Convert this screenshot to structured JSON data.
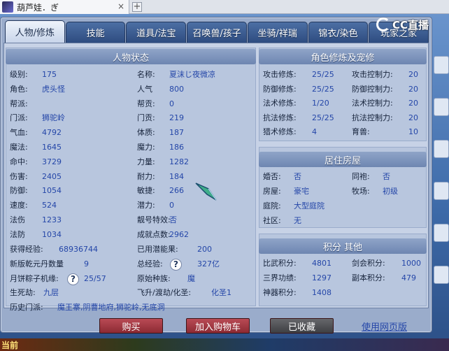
{
  "browser": {
    "tab_title": "葫芦娃．ぎ",
    "close_glyph": "×",
    "new_tab_glyph": "+"
  },
  "watermark": {
    "text": "CC直播"
  },
  "tabs": [
    {
      "label": "人物/修炼"
    },
    {
      "label": "技能"
    },
    {
      "label": "道具/法宝"
    },
    {
      "label": "召唤兽/孩子"
    },
    {
      "label": "坐骑/祥瑞"
    },
    {
      "label": "锦衣/染色"
    },
    {
      "label": "玩家之家"
    }
  ],
  "status": {
    "header": "人物状态",
    "left": [
      {
        "label": "级别:",
        "value": "175"
      },
      {
        "label": "角色:",
        "value": "虎头怪"
      },
      {
        "label": "帮派:",
        "value": ""
      },
      {
        "label": "门派:",
        "value": "狮驼岭"
      },
      {
        "label": "气血:",
        "value": "4792"
      },
      {
        "label": "魔法:",
        "value": "1645"
      },
      {
        "label": "命中:",
        "value": "3729"
      },
      {
        "label": "伤害:",
        "value": "2405"
      },
      {
        "label": "防御:",
        "value": "1054"
      },
      {
        "label": "速度:",
        "value": "524"
      },
      {
        "label": "法伤",
        "value": "1233"
      },
      {
        "label": "法防",
        "value": "1034"
      }
    ],
    "right": [
      {
        "label": "名称:",
        "value": "夏沫じ夜微凉"
      },
      {
        "label": "人气",
        "value": "800"
      },
      {
        "label": "帮贡:",
        "value": "0"
      },
      {
        "label": "门贡:",
        "value": "219"
      },
      {
        "label": "体质:",
        "value": "187"
      },
      {
        "label": "魔力:",
        "value": "186"
      },
      {
        "label": "力量:",
        "value": "1282"
      },
      {
        "label": "耐力:",
        "value": "184"
      },
      {
        "label": "敏捷:",
        "value": "266"
      },
      {
        "label": "潜力:",
        "value": "0"
      },
      {
        "label": "靓号特效:",
        "value": "否"
      },
      {
        "label": "成就点数:",
        "value": "2962"
      }
    ],
    "exp": {
      "label": "获得经验:",
      "value": "68936744"
    },
    "potential": {
      "label": "已用潜能果:",
      "value": "200"
    },
    "qianyuan": {
      "label": "新版乾元丹数量",
      "value": "9"
    },
    "total_exp": {
      "label": "总经验:",
      "help": "?",
      "value": "327亿"
    },
    "moon": {
      "label": "月饼粽子机缘:",
      "help": "?",
      "value": "25/57"
    },
    "race": {
      "label": "原始种族:",
      "value": "魔"
    },
    "life": {
      "label": "生死劫:",
      "value": "九层"
    },
    "ascend": {
      "label": "飞升/渡劫/化圣:",
      "value": "化圣1"
    },
    "history": {
      "label": "历史门派:",
      "value": "魔王寨,阴曹地府,狮驼岭,无底洞"
    }
  },
  "cultivation": {
    "header": "角色修炼及宠修",
    "rows": [
      {
        "l1": "攻击修炼:",
        "v1": "25/25",
        "l2": "攻击控制力:",
        "v2": "20"
      },
      {
        "l1": "防御修炼:",
        "v1": "25/25",
        "l2": "防御控制力:",
        "v2": "20"
      },
      {
        "l1": "法术修炼:",
        "v1": "1/20",
        "l2": "法术控制力:",
        "v2": "20"
      },
      {
        "l1": "抗法修炼:",
        "v1": "25/25",
        "l2": "抗法控制力:",
        "v2": "20"
      },
      {
        "l1": "猎术修炼:",
        "v1": "4",
        "l2": "育兽:",
        "v2": "10"
      }
    ]
  },
  "housing": {
    "header": "居住房屋",
    "married": {
      "label": "婚否:",
      "value": "否"
    },
    "sworn": {
      "label": "同袍:",
      "value": "否"
    },
    "house": {
      "label": "房屋:",
      "value": "豪宅"
    },
    "ranch": {
      "label": "牧场:",
      "value": "初级"
    },
    "yard": {
      "label": "庭院:",
      "value": "大型庭院"
    },
    "community": {
      "label": "社区:",
      "value": "无"
    }
  },
  "points": {
    "header": "积分 其他",
    "rows": [
      {
        "l1": "比武积分:",
        "v1": "4801",
        "l2": "剑会积分:",
        "v2": "1000"
      },
      {
        "l1": "三界功绩:",
        "v1": "1297",
        "l2": "副本积分:",
        "v2": "479"
      },
      {
        "l1": "神器积分:",
        "v1": "1408",
        "l2": "",
        "v2": ""
      }
    ]
  },
  "actions": {
    "buy": "购买",
    "add_cart": "加入购物车",
    "saved": "已收藏",
    "web": "使用网页版"
  },
  "bottom": {
    "now": "当前"
  }
}
